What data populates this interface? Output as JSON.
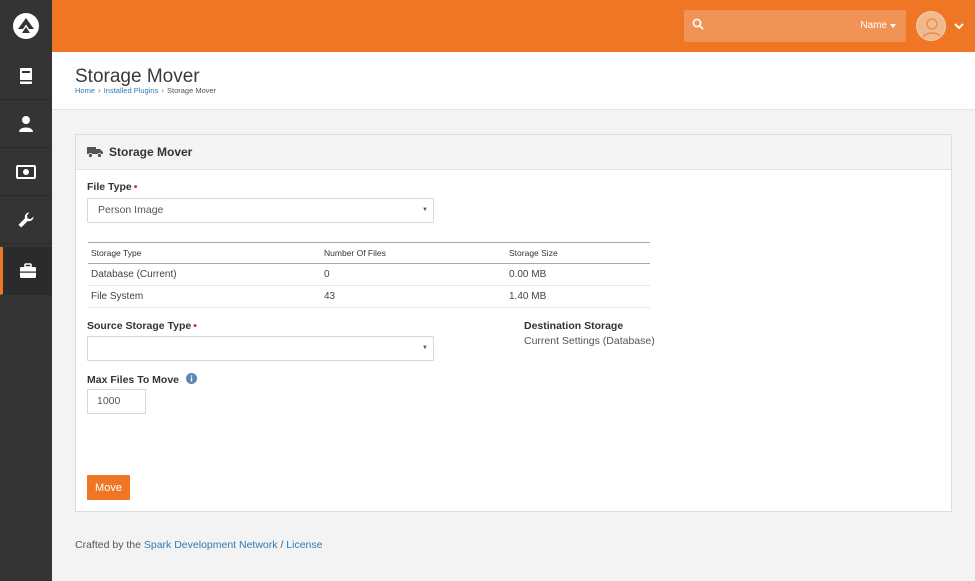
{
  "header": {
    "search_filter_label": "Name",
    "search_placeholder": ""
  },
  "sidebar": {
    "items": [
      {
        "icon": "book-icon"
      },
      {
        "icon": "person-icon"
      },
      {
        "icon": "money-icon"
      },
      {
        "icon": "wrench-icon"
      },
      {
        "icon": "briefcase-icon"
      }
    ]
  },
  "page": {
    "title": "Storage Mover",
    "breadcrumb": [
      "Home",
      "Installed Plugins",
      "Storage Mover"
    ]
  },
  "panel": {
    "title": "Storage Mover",
    "file_type_label": "File Type",
    "file_type_value": "Person Image",
    "table": {
      "headers": [
        "Storage Type",
        "Number Of Files",
        "Storage Size"
      ],
      "rows": [
        [
          "Database (Current)",
          "0",
          "0.00 MB"
        ],
        [
          "File System",
          "43",
          "1.40 MB"
        ]
      ]
    },
    "source_label": "Source Storage Type",
    "source_value": "",
    "destination_label": "Destination Storage",
    "destination_value": "Current Settings (Database)",
    "max_files_label": "Max Files To Move",
    "max_files_value": "1000",
    "move_button": "Move"
  },
  "footer": {
    "prefix": "Crafted by the",
    "link1": "Spark Development Network",
    "sep": "/",
    "link2": "License"
  },
  "colors": {
    "accent": "#ee7625",
    "sidebar": "#343434",
    "link": "#2b7bb9"
  }
}
